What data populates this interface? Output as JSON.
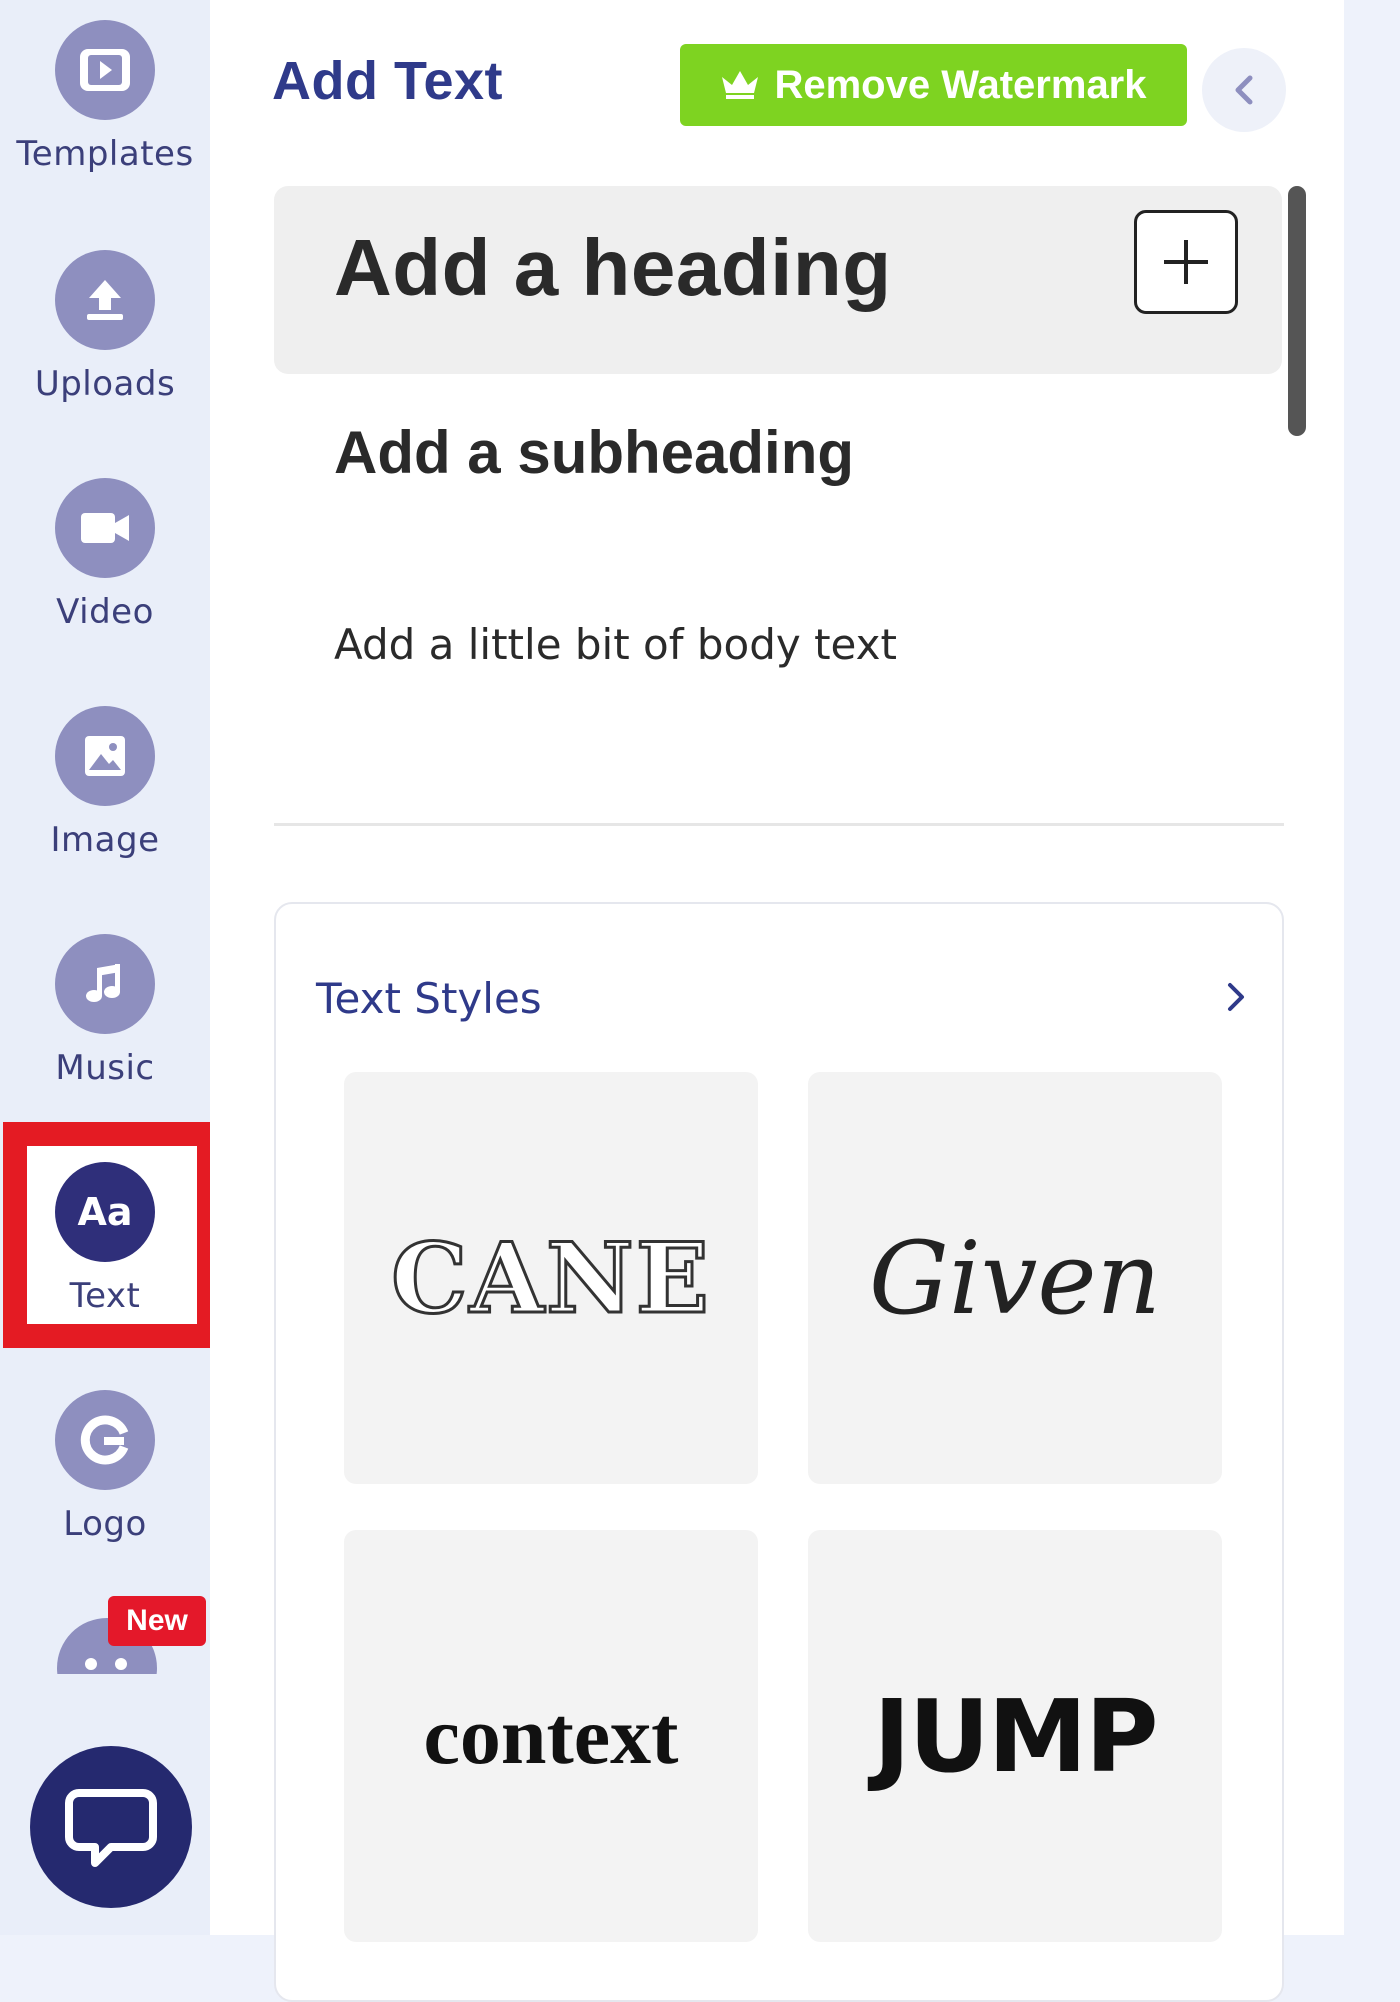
{
  "sidebar": {
    "items": [
      {
        "label": "Templates",
        "icon": "film-icon"
      },
      {
        "label": "Uploads",
        "icon": "upload-icon"
      },
      {
        "label": "Video",
        "icon": "video-camera-icon"
      },
      {
        "label": "Image",
        "icon": "image-icon"
      },
      {
        "label": "Music",
        "icon": "music-note-icon"
      },
      {
        "label": "Text",
        "icon": "text-aa-icon",
        "active": true,
        "icon_text": "Aa"
      },
      {
        "label": "Logo",
        "icon": "logo-g-icon"
      }
    ],
    "new_badge": "New",
    "colors": {
      "icon_bg": "#8e8fbf",
      "active_icon_bg": "#2f2f7a",
      "highlight": "#e41b23"
    }
  },
  "panel": {
    "title": "Add Text",
    "watermark_button": "Remove Watermark",
    "heading_label": "Add a heading",
    "subheading_label": "Add a subheading",
    "body_label": "Add a little bit of body text",
    "text_styles": {
      "title": "Text Styles",
      "items": [
        "CANE",
        "Given",
        "context",
        "JUMP"
      ]
    },
    "colors": {
      "watermark_green": "#7ed321",
      "title_blue": "#2f3a8a"
    }
  }
}
